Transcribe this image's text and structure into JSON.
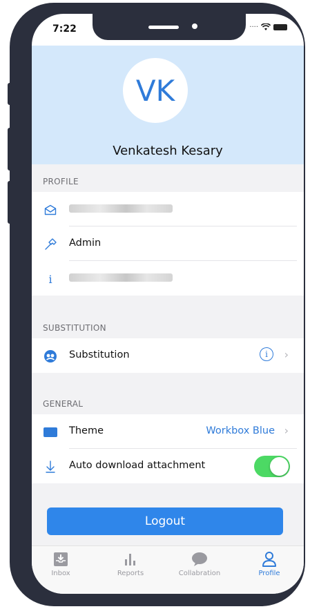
{
  "status_bar": {
    "time": "7:22"
  },
  "profile_header": {
    "initials": "VK",
    "name": "Venkatesh Kesary"
  },
  "sections": {
    "profile": "PROFILE",
    "substitution": "SUBSTITUTION",
    "general": "GENERAL"
  },
  "profile_rows": {
    "email_icon": "envelope-icon",
    "role": "Admin",
    "role_icon": "hammer-icon",
    "info_icon": "info-icon"
  },
  "substitution_row": {
    "label": "Substitution",
    "icon": "substitution-icon"
  },
  "general_rows": {
    "theme_label": "Theme",
    "theme_value": "Workbox Blue",
    "auto_download_label": "Auto download attachment",
    "auto_download_enabled": true
  },
  "logout_label": "Logout",
  "tabs": [
    {
      "label": "Inbox",
      "icon": "inbox-icon"
    },
    {
      "label": "Reports",
      "icon": "bar-chart-icon"
    },
    {
      "label": "Collabration",
      "icon": "chat-bubble-icon"
    },
    {
      "label": "Profile",
      "icon": "person-icon",
      "active": true
    }
  ],
  "colors": {
    "accent": "#2f7bd9",
    "header_bg": "#d4e8fb",
    "toggle_on": "#4cd964",
    "logout_bg": "#2f86ea"
  }
}
